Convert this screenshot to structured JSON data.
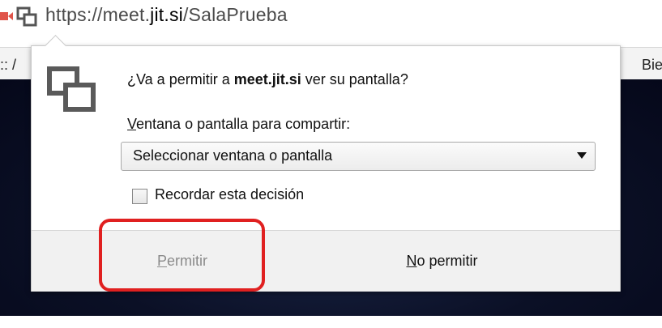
{
  "urlbar": {
    "camera_icon": "video-camera-icon",
    "share_icon": "screen-share-icon",
    "url_prefix": "https://meet.",
    "url_host": "jit.si",
    "url_path": "/SalaPrueba"
  },
  "background": {
    "left_stub_text": ":: /",
    "right_stub_text": "Bie"
  },
  "popup": {
    "icon": "screen-share-icon",
    "question_prefix": "¿Va a permitir a ",
    "question_site": "meet.jit.si",
    "question_suffix": " ver su pantalla?",
    "select_label_underlined": "V",
    "select_label_rest": "entana o pantalla para compartir:",
    "select_value": "Seleccionar ventana o pantalla",
    "checkbox_checked": false,
    "checkbox_label": "Recordar esta decisión",
    "allow_underlined": "P",
    "allow_rest": "ermitir",
    "deny_underlined": "N",
    "deny_rest": "o permitir"
  },
  "colors": {
    "highlight": "#e02020",
    "camera_red": "#e0544a"
  }
}
